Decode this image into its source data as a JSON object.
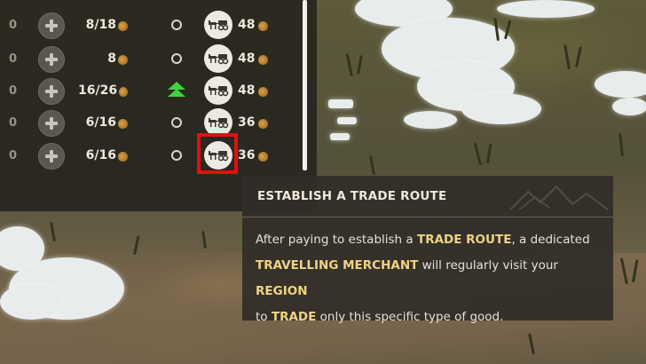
{
  "trade_rows": [
    {
      "count": "0",
      "stock": "8/18",
      "status": "neutral",
      "price": "48"
    },
    {
      "count": "0",
      "stock": "8",
      "status": "neutral",
      "price": "48"
    },
    {
      "count": "0",
      "stock": "16/26",
      "status": "up",
      "price": "48"
    },
    {
      "count": "0",
      "stock": "6/16",
      "status": "neutral",
      "price": "36"
    },
    {
      "count": "0",
      "stock": "6/16",
      "status": "neutral",
      "price": "36"
    }
  ],
  "icons": {
    "add": "plus-icon",
    "currency": "coin-sack-icon",
    "status_neutral": "ring-icon",
    "status_up": "green-double-arrow-up-icon",
    "trade_route": "horse-cart-icon"
  },
  "colors": {
    "highlight": "#e31010",
    "keyword": "#f0d383",
    "status_up": "#3fd23a"
  },
  "tooltip": {
    "title": "ESTABLISH A TRADE ROUTE",
    "line1_a": "After paying to establish a ",
    "line1_kw": "TRADE ROUTE",
    "line1_b": ", a dedicated",
    "line2_kw1": "TRAVELLING MERCHANT",
    "line2_b": " will regularly visit your ",
    "line2_kw2": "REGION",
    "line3_a": "to ",
    "line3_kw": "TRADE",
    "line3_b": " only this specific type of good."
  }
}
